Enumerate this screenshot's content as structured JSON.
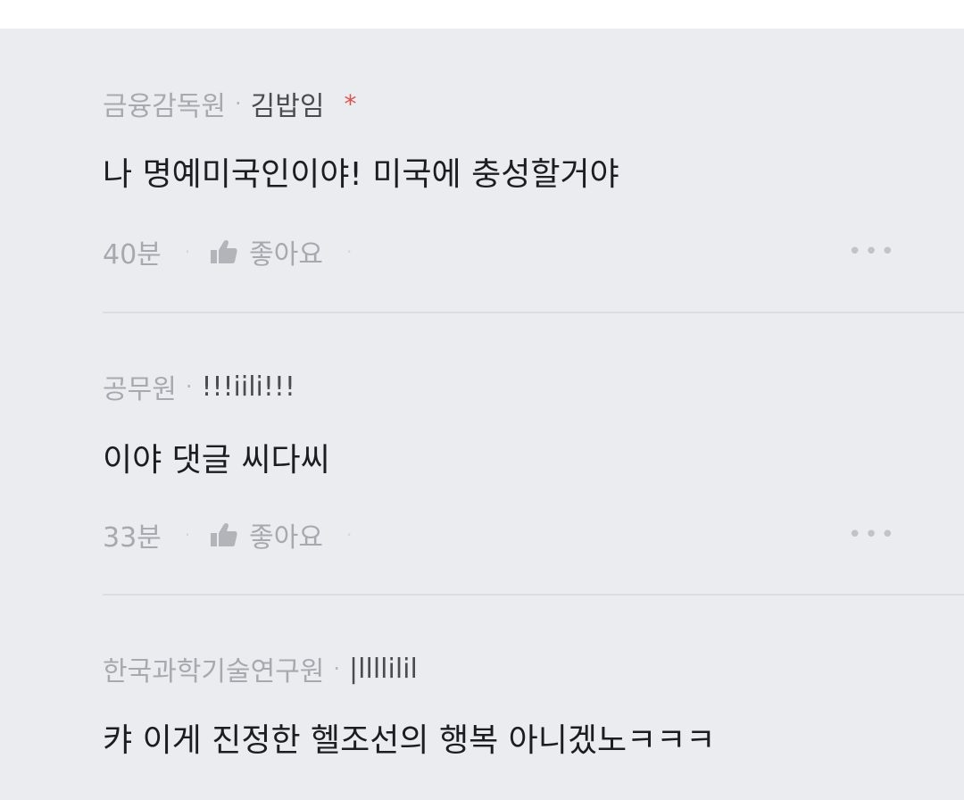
{
  "comments": [
    {
      "org": "금융감독원",
      "separator": "·",
      "nickname": "김밥임",
      "badge": "*",
      "text": "나 명예미국인이야! 미국에 충성할거야",
      "time": "40분",
      "like_label": "좋아요",
      "more": "•••"
    },
    {
      "org": "공무원",
      "separator": "·",
      "nickname": "!!!iili!!!",
      "text": "이야 댓글 씨다씨",
      "time": "33분",
      "like_label": "좋아요",
      "more": "•••"
    },
    {
      "org": "한국과학기술연구원",
      "separator": "·",
      "nickname": "|llllilil",
      "text": "캬 이게 진정한 헬조선의 행복 아니겠노ㅋㅋㅋ"
    }
  ],
  "icons": {
    "like": "thumbs-up-icon",
    "more": "more-options-icon"
  },
  "colors": {
    "background": "#ebecf0",
    "badge": "#d9534f",
    "muted_text": "#a8a9b0",
    "body_text": "#1d1d1f"
  }
}
